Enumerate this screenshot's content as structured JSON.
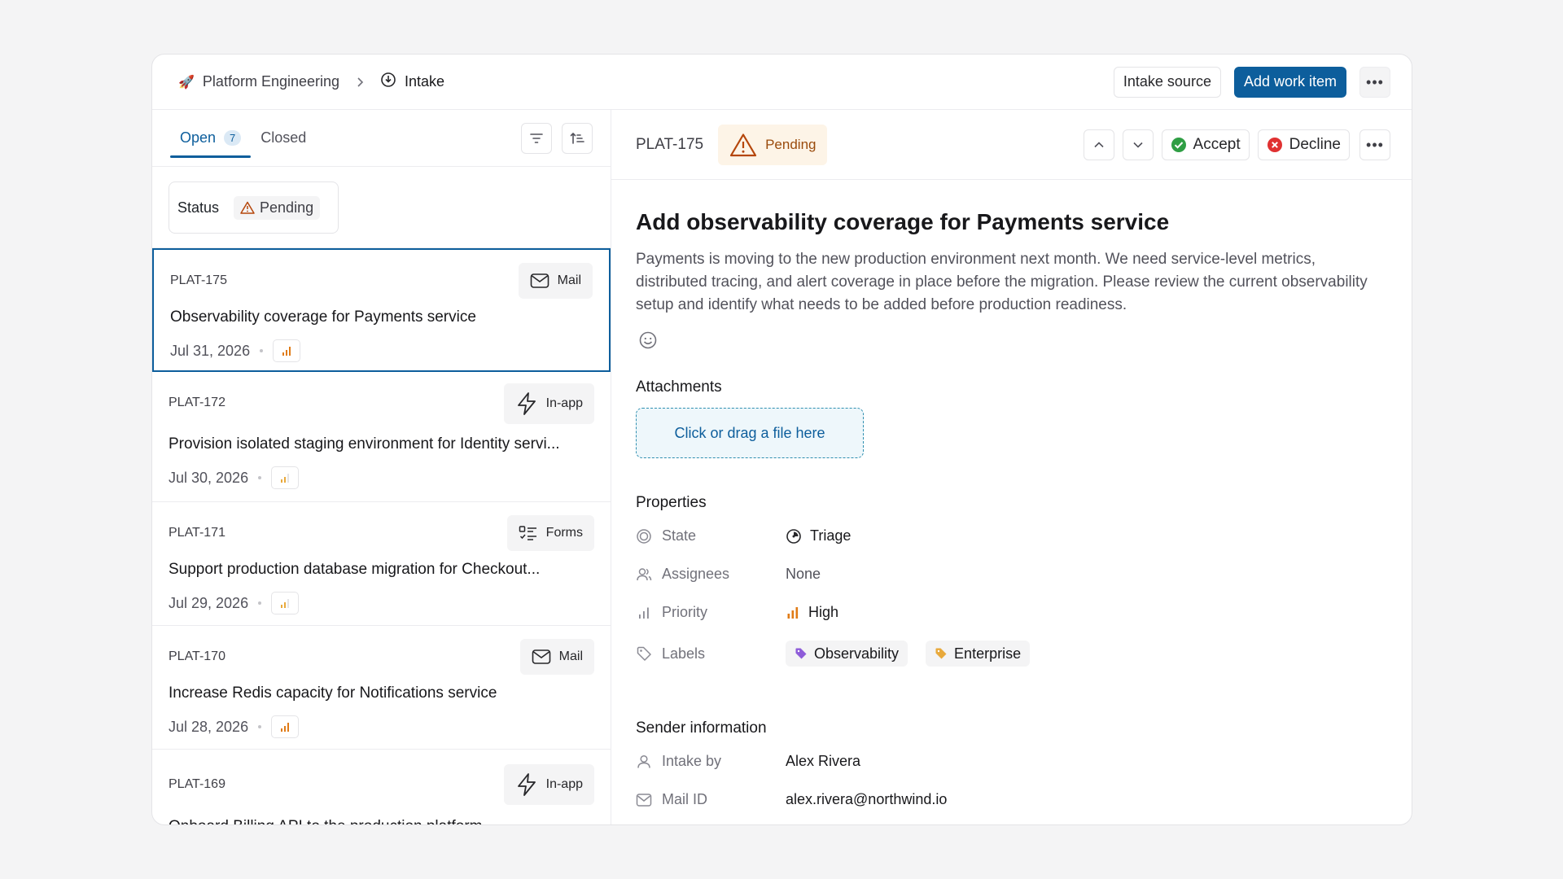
{
  "header": {
    "workspace": "Platform Engineering",
    "section": "Intake",
    "intake_source_label": "Intake source",
    "add_work_item_label": "Add work item"
  },
  "tabs": {
    "open_label": "Open",
    "open_count": "7",
    "closed_label": "Closed"
  },
  "filter": {
    "label": "Status",
    "value": "Pending"
  },
  "items": [
    {
      "id": "PLAT-175",
      "source": "Mail",
      "source_icon": "mail-icon",
      "title": "Observability coverage for Payments service",
      "date": "Jul 31, 2026"
    },
    {
      "id": "PLAT-172",
      "source": "In-app",
      "source_icon": "bolt-icon",
      "title": "Provision isolated staging environment for Identity servi...",
      "date": "Jul 30, 2026"
    },
    {
      "id": "PLAT-171",
      "source": "Forms",
      "source_icon": "form-list-icon",
      "title": "Support production database migration for Checkout...",
      "date": "Jul 29, 2026"
    },
    {
      "id": "PLAT-170",
      "source": "Mail",
      "source_icon": "mail-icon",
      "title": "Increase Redis capacity for Notifications service",
      "date": "Jul 28, 2026"
    },
    {
      "id": "PLAT-169",
      "source": "In-app",
      "source_icon": "bolt-icon",
      "title": "Onboard Billing API to the production platform",
      "date": ""
    }
  ],
  "detail": {
    "id": "PLAT-175",
    "status": "Pending",
    "accept_label": "Accept",
    "decline_label": "Decline",
    "title": "Add observability coverage for Payments service",
    "description": "Payments is moving to the new production environment next month. We need service-level metrics, distributed tracing, and alert coverage in place before the migration. Please review the current observability setup and identify what needs to be added before production readiness.",
    "attachments_heading": "Attachments",
    "dropzone_text": "Click or drag a file here",
    "properties_heading": "Properties",
    "state_label": "State",
    "state_value": "Triage",
    "assignees_label": "Assignees",
    "assignees_value": "None",
    "priority_label": "Priority",
    "priority_value": "High",
    "labels_label": "Labels",
    "labels": [
      "Observability",
      "Enterprise"
    ],
    "sender_heading": "Sender information",
    "intake_by_label": "Intake by",
    "intake_by_value": "Alex Rivera",
    "mail_id_label": "Mail ID",
    "mail_id_value": "alex.rivera@northwind.io"
  },
  "colors": {
    "accent": "#0d5e9c",
    "pending": "#b5460b",
    "priority_high": "#e07b16",
    "accept": "#2f9e44",
    "decline": "#e03131",
    "label_observability": "#8e5cd9",
    "label_enterprise": "#e8a93c"
  }
}
